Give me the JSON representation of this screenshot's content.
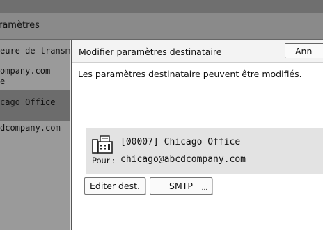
{
  "background": {
    "title": "ramètres",
    "list_items": [
      "eure de transm",
      "ompany.com",
      "e",
      "cago Office",
      "dcompany.com"
    ]
  },
  "dialog": {
    "title": "Modifier paramètres destinataire",
    "cancel_label": "Ann",
    "message": "Les paramètres destinataire peuvent être modifiés.",
    "destination": {
      "icon": "fax-icon",
      "name": "[00007] Chicago Office",
      "pour_label": "Pour :",
      "email": "chicago@abcdcompany.com"
    },
    "buttons": {
      "edit_label": "Editer dest.",
      "smtp_label": "SMTP",
      "smtp_more": "..."
    }
  }
}
